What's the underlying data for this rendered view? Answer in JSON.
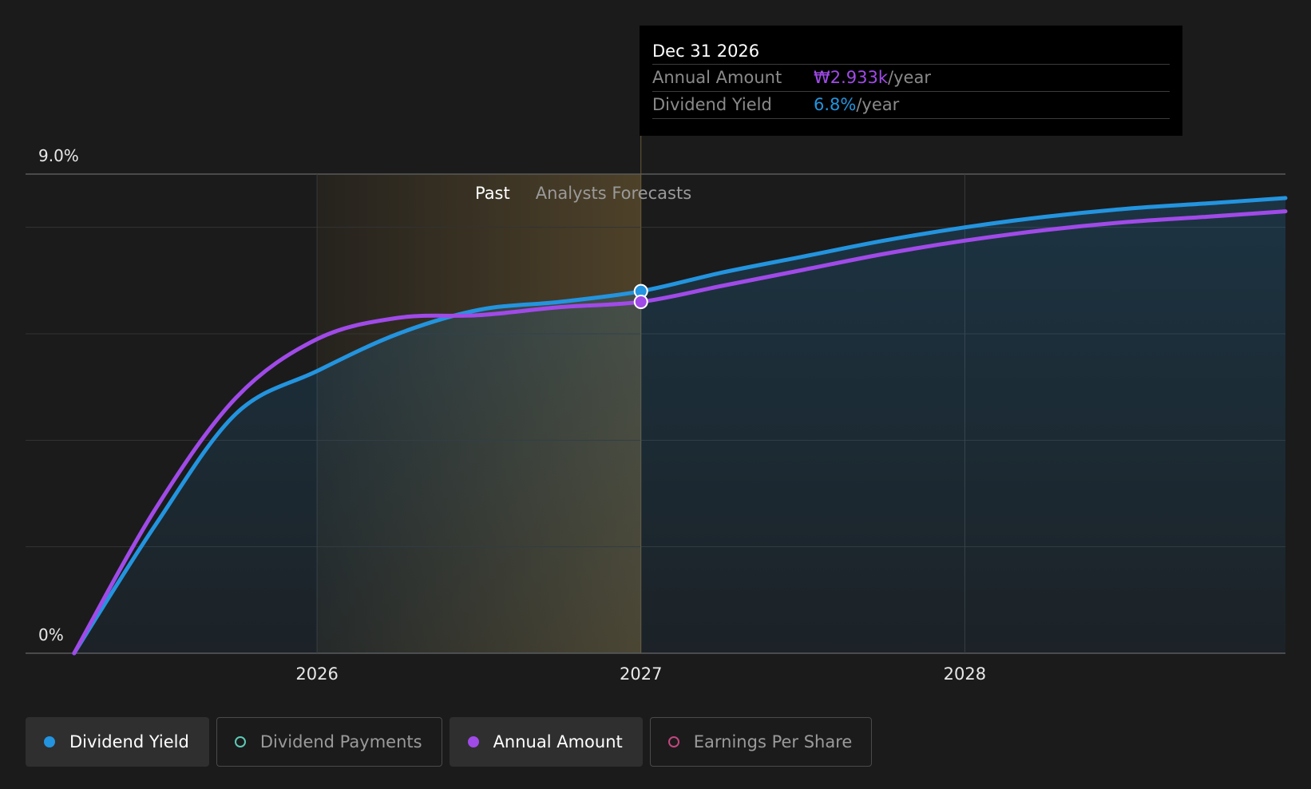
{
  "colors": {
    "dividend_yield": "#2394df",
    "annual_amount": "#a04ae8",
    "dividend_payments": "#5fc9b6",
    "earnings_per_share": "#c2477f",
    "background": "#1b1b1b",
    "past_region": "#c49a4a"
  },
  "tooltip": {
    "date": "Dec 31 2026",
    "rows": [
      {
        "label": "Annual Amount",
        "value": "₩2.933k",
        "unit": "/year",
        "color": "#a04ae8"
      },
      {
        "label": "Dividend Yield",
        "value": "6.8%",
        "unit": "/year",
        "color": "#2394df"
      }
    ]
  },
  "regions": {
    "past_label": "Past",
    "forecast_label": "Analysts Forecasts"
  },
  "legend": [
    {
      "label": "Dividend Yield",
      "active": true,
      "icon": "filled-circle-icon",
      "color": "#2394df"
    },
    {
      "label": "Dividend Payments",
      "active": false,
      "icon": "hollow-circle-icon",
      "color": "#5fc9b6"
    },
    {
      "label": "Annual Amount",
      "active": true,
      "icon": "filled-circle-icon",
      "color": "#a04ae8"
    },
    {
      "label": "Earnings Per Share",
      "active": false,
      "icon": "hollow-circle-icon",
      "color": "#c2477f"
    }
  ],
  "chart_data": {
    "type": "line",
    "title": "",
    "xlabel": "",
    "ylabel": "",
    "ylim": [
      0,
      9.0
    ],
    "y_tick_labels": [
      "0%",
      "9.0%"
    ],
    "x_tick_labels": [
      "2026",
      "2027",
      "2028"
    ],
    "x_ticks": [
      2026,
      2027,
      2028
    ],
    "xlim": [
      2025.1,
      2028.99
    ],
    "past_forecast_divider": 2027.0,
    "grid": true,
    "highlight_x": 2027.0,
    "series": [
      {
        "name": "Dividend Yield",
        "key": "dividend_yield",
        "area": true,
        "x": [
          2025.25,
          2025.5,
          2025.75,
          2026.0,
          2026.25,
          2026.5,
          2026.75,
          2027.0,
          2027.25,
          2027.5,
          2027.75,
          2028.0,
          2028.25,
          2028.5,
          2028.75,
          2028.99
        ],
        "y": [
          0,
          2.4,
          4.5,
          5.3,
          6.0,
          6.45,
          6.6,
          6.8,
          7.15,
          7.45,
          7.75,
          8.0,
          8.2,
          8.35,
          8.45,
          8.55
        ],
        "values": [
          0,
          2.4,
          4.5,
          5.3,
          6.0,
          6.45,
          6.6,
          6.8,
          7.15,
          7.45,
          7.75,
          8.0,
          8.2,
          8.35,
          8.45,
          8.55
        ]
      },
      {
        "name": "Annual Amount",
        "key": "annual_amount",
        "area": false,
        "x": [
          2025.25,
          2025.5,
          2025.75,
          2026.0,
          2026.25,
          2026.5,
          2026.75,
          2027.0,
          2027.25,
          2027.5,
          2027.75,
          2028.0,
          2028.25,
          2028.5,
          2028.75,
          2028.99
        ],
        "y": [
          0,
          2.7,
          4.8,
          5.9,
          6.3,
          6.35,
          6.5,
          6.6,
          6.9,
          7.2,
          7.5,
          7.75,
          7.95,
          8.1,
          8.2,
          8.3
        ],
        "values": [
          0,
          2.7,
          4.8,
          5.9,
          6.3,
          6.35,
          6.5,
          6.6,
          6.9,
          7.2,
          7.5,
          7.75,
          7.95,
          8.1,
          8.2,
          8.3
        ]
      }
    ]
  }
}
